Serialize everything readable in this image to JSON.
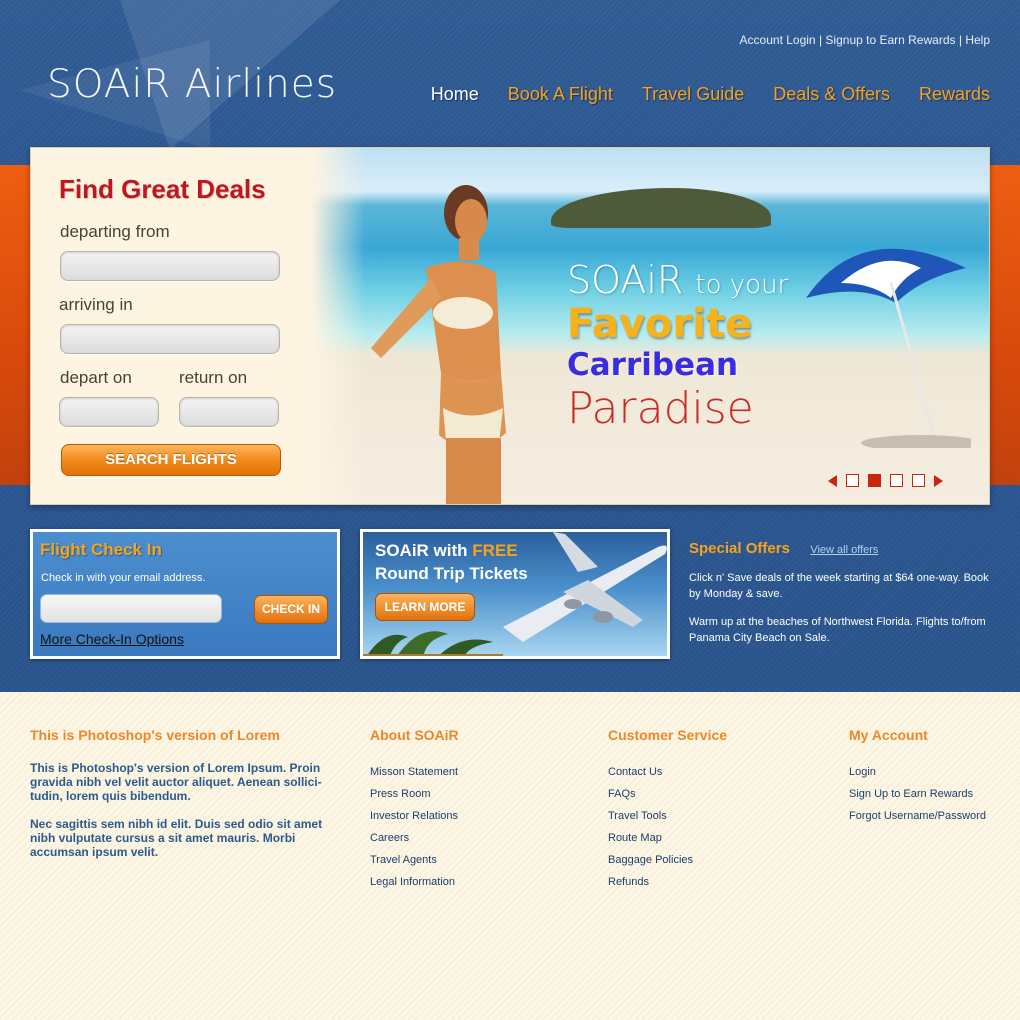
{
  "brand": {
    "logo_text": "SOAiR Airlines"
  },
  "top_links": {
    "login": "Account Login",
    "sep1": "|",
    "signup": "Signup to Earn Rewards",
    "sep2": "|",
    "help": "Help"
  },
  "nav": {
    "items": [
      {
        "label": "Home"
      },
      {
        "label": "Book A Flight"
      },
      {
        "label": "Travel Guide"
      },
      {
        "label": "Deals & Offers"
      },
      {
        "label": "Rewards"
      }
    ]
  },
  "search": {
    "title": "Find Great Deals",
    "departing_label": "departing from",
    "arriving_label": "arriving in",
    "depart_on_label": "depart on",
    "return_on_label": "return on",
    "button_label": "SEARCH FLIGHTS"
  },
  "hero": {
    "line1_brand": "SOAiR",
    "line1_rest": "to your",
    "line2": "Favorite",
    "line3": "Carribean",
    "line4": "Paradise",
    "slider": {
      "count": 4,
      "active_index": 2
    }
  },
  "checkin": {
    "title": "Flight Check In",
    "subtitle": "Check in with your email address.",
    "button_label": "CHECK IN",
    "more_link": "More Check-In Options"
  },
  "promo": {
    "line1_a": "SOAiR with",
    "line1_b": "FREE",
    "line2": "Round Trip Tickets",
    "button_label": "LEARN MORE"
  },
  "special_offers": {
    "title": "Special Offers",
    "view_all": "View all offers",
    "para1": "Click n' Save deals of the week starting at $64 one-way. Book by Monday & save.",
    "para2": "Warm up at the beaches of Northwest Florida. Flights to/from Panama City Beach on Sale."
  },
  "footer": {
    "col1": {
      "heading": "This is Photoshop's version  of Lorem",
      "para1": "This is Photoshop's version  of Lorem Ipsum. Proin gravida nibh vel velit auctor aliquet. Aenean sollici-tudin, lorem quis bibendum.",
      "para2": "Nec sagittis sem nibh id elit. Duis sed odio sit amet nibh vulputate cursus a sit amet mauris. Morbi accumsan ipsum velit."
    },
    "col2": {
      "heading": "About SOAiR",
      "links": [
        "Misson Statement",
        "Press Room",
        "Investor Relations",
        "Careers",
        "Travel Agents",
        "Legal Information"
      ]
    },
    "col3": {
      "heading": "Customer Service",
      "links": [
        "Contact Us",
        "FAQs",
        "Travel Tools",
        "Route Map",
        "Baggage Policies",
        "Refunds"
      ]
    },
    "col4": {
      "heading": "My Account",
      "links": [
        "Login",
        "Sign Up to Earn Rewards",
        "Forgot Username/Password"
      ]
    }
  },
  "colors": {
    "header_blue": "#2b5690",
    "accent_orange": "#f7a319",
    "hero_red": "#c0161d",
    "band_orange": "#e2540f"
  }
}
